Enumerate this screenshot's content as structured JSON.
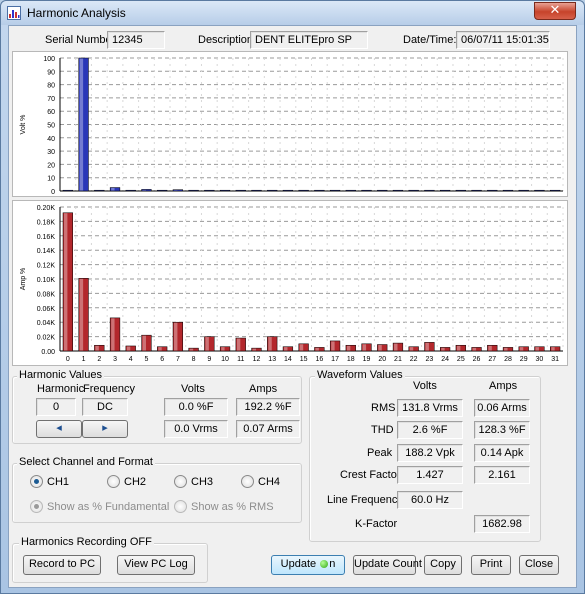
{
  "window": {
    "title": "Harmonic Analysis",
    "close_glyph": "✕"
  },
  "header": {
    "serial_label": "Serial Number:",
    "serial_value": "12345",
    "description_label": "Description:",
    "description_value": "DENT ELITEpro SP",
    "datetime_label": "Date/Time:",
    "datetime_value": "06/07/11  15:01:35"
  },
  "chart_data": [
    {
      "type": "bar",
      "ylabel": "Volt %",
      "ylim": [
        0,
        100
      ],
      "y_ticks": [
        "0",
        "10",
        "20",
        "30",
        "40",
        "50",
        "60",
        "70",
        "80",
        "90",
        "100"
      ],
      "grid": true,
      "categories": [
        "0",
        "1",
        "2",
        "3",
        "4",
        "5",
        "6",
        "7",
        "8",
        "9",
        "10",
        "11",
        "12",
        "13",
        "14",
        "15",
        "16",
        "17",
        "18",
        "19",
        "20",
        "21",
        "22",
        "23",
        "24",
        "25",
        "26",
        "27",
        "28",
        "29",
        "30",
        "31"
      ],
      "values": [
        0,
        100,
        0.3,
        2.6,
        0.4,
        1.2,
        0.3,
        1.0,
        0.2,
        0.5,
        0.2,
        0.4,
        0.2,
        0.3,
        0.2,
        0.2,
        0.1,
        0.2,
        0.1,
        0.1,
        0.1,
        0.1,
        0.1,
        0.1,
        0.1,
        0.1,
        0.1,
        0.1,
        0.1,
        0.1,
        0.1,
        0.1
      ],
      "bar_color": "#2a37b8"
    },
    {
      "type": "bar",
      "ylabel": "Amp %",
      "ylim": [
        0,
        0.2
      ],
      "y_ticks": [
        "0.00",
        "0.02K",
        "0.04K",
        "0.06K",
        "0.08K",
        "0.10K",
        "0.12K",
        "0.14K",
        "0.16K",
        "0.18K",
        "0.20K"
      ],
      "grid": true,
      "categories": [
        "0",
        "1",
        "2",
        "3",
        "4",
        "5",
        "6",
        "7",
        "8",
        "9",
        "10",
        "11",
        "12",
        "13",
        "14",
        "15",
        "16",
        "17",
        "18",
        "19",
        "20",
        "21",
        "22",
        "23",
        "24",
        "25",
        "26",
        "27",
        "28",
        "29",
        "30",
        "31"
      ],
      "values": [
        0.192,
        0.101,
        0.008,
        0.046,
        0.007,
        0.022,
        0.006,
        0.04,
        0.004,
        0.02,
        0.006,
        0.018,
        0.004,
        0.02,
        0.006,
        0.01,
        0.005,
        0.014,
        0.008,
        0.01,
        0.009,
        0.011,
        0.006,
        0.012,
        0.005,
        0.008,
        0.005,
        0.008,
        0.005,
        0.006,
        0.006,
        0.006
      ],
      "bar_color": "#b3272c"
    }
  ],
  "harmonic_values": {
    "title": "Harmonic Values",
    "harmonic_header": "Harmonic",
    "frequency_header": "Frequency",
    "volts_header": "Volts",
    "amps_header": "Amps",
    "harmonic_value": "0",
    "frequency_value": "DC",
    "volts_pct": "0.0 %F",
    "amps_pct": "192.2 %F",
    "volts_rms": "0.0 Vrms",
    "amps_rms": "0.07 Arms",
    "spin_left": "◂",
    "spin_right": "▸"
  },
  "channel_format": {
    "title": "Select Channel and Format",
    "channels": [
      "CH1",
      "CH2",
      "CH3",
      "CH4"
    ],
    "selected_channel": "CH1",
    "format_fundamental": "Show as % Fundamental",
    "format_rms": "Show as % RMS"
  },
  "waveform": {
    "title": "Waveform Values",
    "volts_header": "Volts",
    "amps_header": "Amps",
    "rms_label": "RMS",
    "rms_volts": "131.8 Vrms",
    "rms_amps": "0.06 Arms",
    "thd_label": "THD",
    "thd_volts": "2.6 %F",
    "thd_amps": "128.3 %F",
    "peak_label": "Peak",
    "peak_volts": "188.2 Vpk",
    "peak_amps": "0.14 Apk",
    "crest_label": "Crest Factor",
    "crest_volts": "1.427",
    "crest_amps": "2.161",
    "linefreq_label": "Line Frequency",
    "linefreq_value": "60.0 Hz",
    "kfactor_label": "K-Factor",
    "kfactor_value": "1682.98"
  },
  "recording": {
    "title": "Harmonics Recording OFF",
    "record_button": "Record to PC",
    "viewlog_button": "View PC Log"
  },
  "buttons": {
    "update_on_prefix": "Update ",
    "update_on_suffix": "n",
    "update_count": "Update Count",
    "copy": "Copy",
    "print": "Print",
    "close": "Close"
  }
}
